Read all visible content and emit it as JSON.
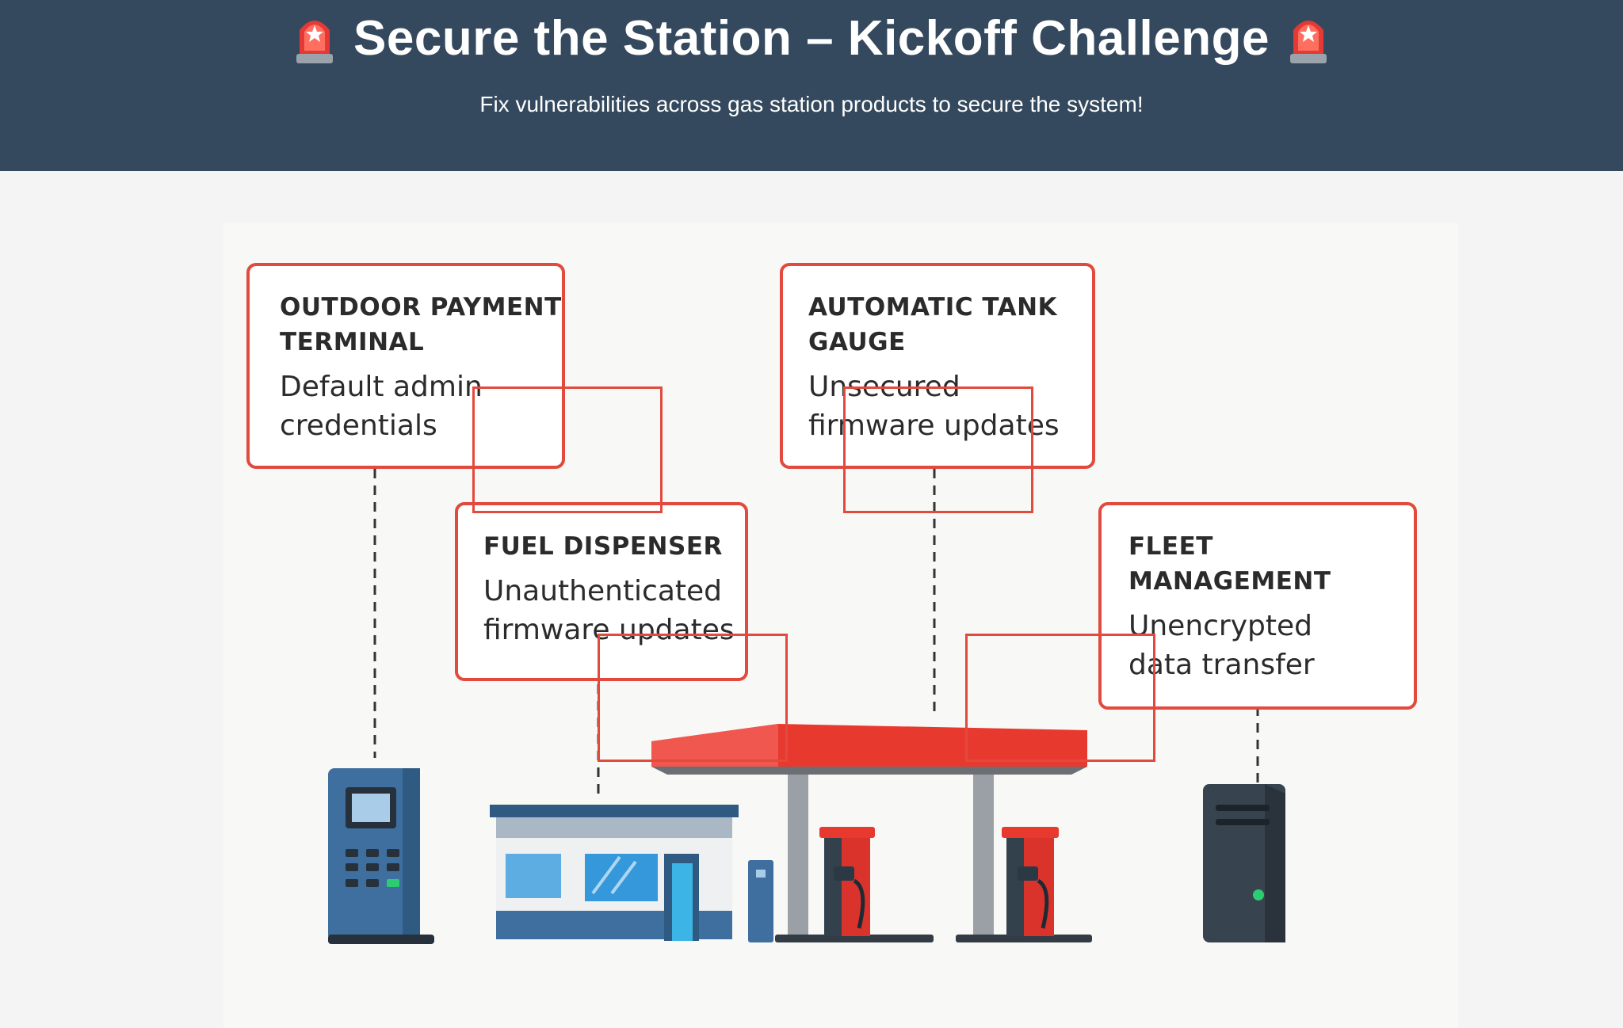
{
  "header": {
    "title": "Secure the Station – Kickoff Challenge",
    "subtitle": "Fix vulnerabilities across gas station products to secure the system!",
    "icon_left": "siren-icon",
    "icon_right": "siren-icon",
    "background": "#34495e"
  },
  "cards": [
    {
      "id": "outdoor-payment-terminal",
      "title_lines": [
        "OUTDOOR PAYMENT",
        "TERMINAL"
      ],
      "desc_lines": [
        "Default admin",
        "credentials"
      ]
    },
    {
      "id": "automatic-tank-gauge",
      "title_lines": [
        "AUTOMATIC TANK",
        "GAUGE"
      ],
      "desc_lines": [
        "Unsecured",
        "firmware updates"
      ]
    },
    {
      "id": "fuel-dispenser",
      "title_lines": [
        "FUEL DISPENSER"
      ],
      "desc_lines": [
        "Unauthenticated",
        "firmware updates"
      ]
    },
    {
      "id": "fleet-management",
      "title_lines": [
        "FLEET",
        "MANAGEMENT"
      ],
      "desc_lines": [
        "Unencrypted",
        "data transfer"
      ]
    }
  ],
  "colors": {
    "accent": "#e14a3c",
    "canopy": "#e8392f",
    "building_blue": "#3e6f9e",
    "server": "#37434f"
  }
}
